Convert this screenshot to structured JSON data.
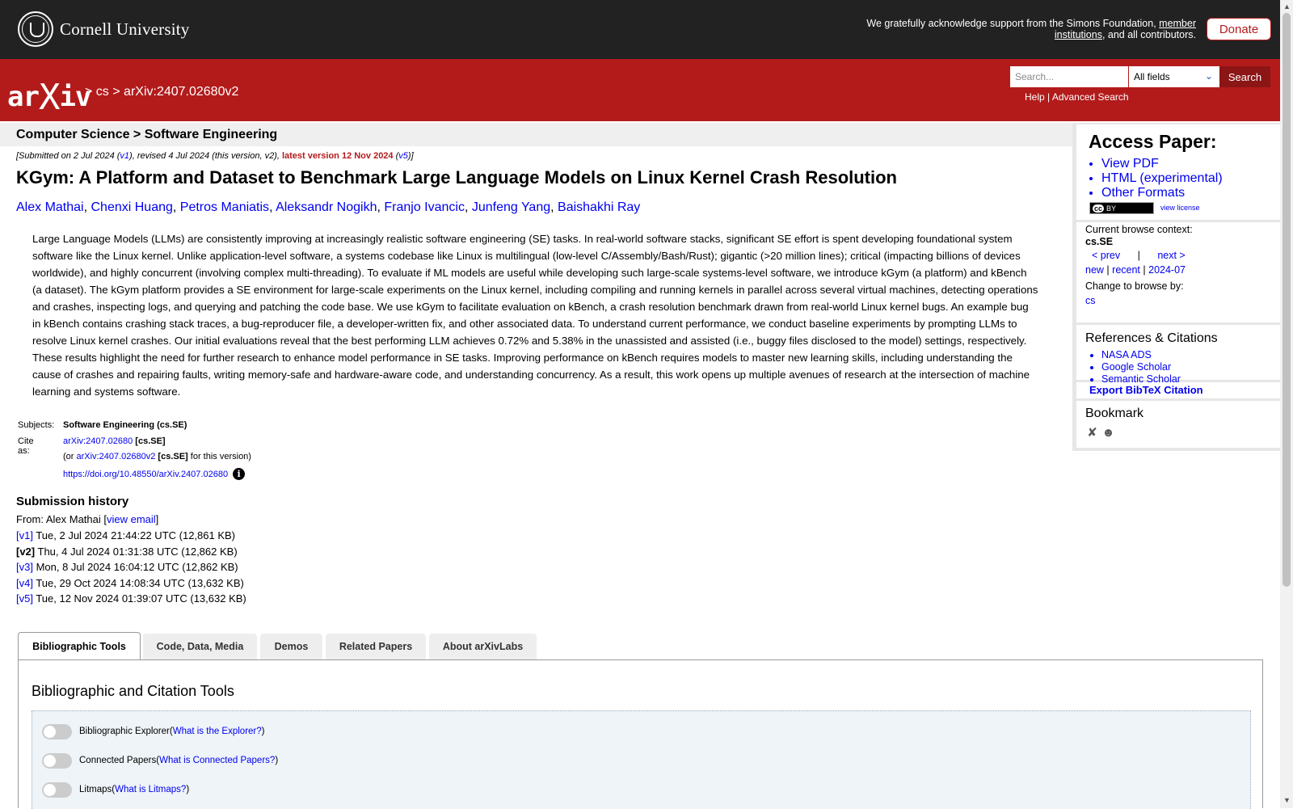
{
  "topbar": {
    "university": "Cornell University",
    "ack_prefix": "We gratefully acknowledge support from the Simons Foundation, ",
    "ack_link": "member institutions",
    "ack_suffix": ", and all contributors.",
    "donate": "Donate"
  },
  "header": {
    "logo_ar": "ar",
    "logo_x": "X",
    "logo_iv": "iv",
    "crumb_sep": ">",
    "crumb_cs": "cs",
    "crumb_id": "arXiv:2407.02680v2",
    "search_placeholder": "Search...",
    "field_select": "All fields",
    "search_button": "Search",
    "help": "Help",
    "help_sep": "|",
    "advanced": "Advanced Search"
  },
  "subject_bar": "Computer Science > Software Engineering",
  "submitted": {
    "p1": "[Submitted on 2 Jul 2024 (",
    "v1": "v1",
    "p2": "), revised 4 Jul 2024 (this version, v2), ",
    "latest": "latest version 12 Nov 2024",
    "p3": " (",
    "v5": "v5",
    "p4": ")]"
  },
  "title": "KGym: A Platform and Dataset to Benchmark Large Language Models on Linux Kernel Crash Resolution",
  "authors": [
    "Alex Mathai",
    "Chenxi Huang",
    "Petros Maniatis",
    "Aleksandr Nogikh",
    "Franjo Ivancic",
    "Junfeng Yang",
    "Baishakhi Ray"
  ],
  "abstract": "Large Language Models (LLMs) are consistently improving at increasingly realistic software engineering (SE) tasks. In real-world software stacks, significant SE effort is spent developing foundational system software like the Linux kernel. Unlike application-level software, a systems codebase like Linux is multilingual (low-level C/Assembly/Bash/Rust); gigantic (>20 million lines); critical (impacting billions of devices worldwide), and highly concurrent (involving complex multi-threading). To evaluate if ML models are useful while developing such large-scale systems-level software, we introduce kGym (a platform) and kBench (a dataset). The kGym platform provides a SE environment for large-scale experiments on the Linux kernel, including compiling and running kernels in parallel across several virtual machines, detecting operations and crashes, inspecting logs, and querying and patching the code base. We use kGym to facilitate evaluation on kBench, a crash resolution benchmark drawn from real-world Linux kernel bugs. An example bug in kBench contains crashing stack traces, a bug-reproducer file, a developer-written fix, and other associated data. To understand current performance, we conduct baseline experiments by prompting LLMs to resolve Linux kernel crashes. Our initial evaluations reveal that the best performing LLM achieves 0.72% and 5.38% in the unassisted and assisted (i.e., buggy files disclosed to the model) settings, respectively. These results highlight the need for further research to enhance model performance in SE tasks. Improving performance on kBench requires models to master new learning skills, including understanding the cause of crashes and repairing faults, writing memory-safe and hardware-aware code, and understanding concurrency. As a result, this work opens up multiple avenues of research at the intersection of machine learning and systems software.",
  "meta": {
    "subjects_label": "Subjects:",
    "subjects_value": "Software Engineering (cs.SE)",
    "cite_label": "Cite as:",
    "cite_id": "arXiv:2407.02680",
    "cite_cat": " [cs.SE]",
    "or_prefix": "(or ",
    "or_id": "arXiv:2407.02680v2",
    "or_cat": " [cs.SE]",
    "or_suffix": " for this version)",
    "doi": "https://doi.org/10.48550/arXiv.2407.02680",
    "info_glyph": "i"
  },
  "history": {
    "title": "Submission history",
    "from_prefix": "From: Alex Mathai [",
    "from_link": "view email",
    "from_suffix": "]",
    "versions": [
      {
        "tag": "[v1]",
        "text": " Tue, 2 Jul 2024 21:44:22 UTC (12,861 KB)",
        "link": true
      },
      {
        "tag": "[v2]",
        "text": " Thu, 4 Jul 2024 01:31:38 UTC (12,862 KB)",
        "link": false
      },
      {
        "tag": "[v3]",
        "text": " Mon, 8 Jul 2024 16:04:12 UTC (12,862 KB)",
        "link": true
      },
      {
        "tag": "[v4]",
        "text": " Tue, 29 Oct 2024 14:08:34 UTC (13,632 KB)",
        "link": true
      },
      {
        "tag": "[v5]",
        "text": " Tue, 12 Nov 2024 01:39:07 UTC (13,632 KB)",
        "link": true
      }
    ]
  },
  "tabs": [
    "Bibliographic Tools",
    "Code, Data, Media",
    "Demos",
    "Related Papers",
    "About arXivLabs"
  ],
  "panel": {
    "title": "Bibliographic and Citation Tools",
    "tools": [
      {
        "label": "Bibliographic Explorer",
        "open": " (",
        "link": "What is the Explorer?",
        "close": ")"
      },
      {
        "label": "Connected Papers",
        "open": " (",
        "link": "What is Connected Papers?",
        "close": ")"
      },
      {
        "label": "Litmaps",
        "open": " (",
        "link": "What is Litmaps?",
        "close": ")"
      }
    ]
  },
  "sidebar": {
    "access_title": "Access Paper:",
    "access_links": [
      "View PDF",
      "HTML (experimental)",
      "Other Formats"
    ],
    "cc_label": "cc",
    "cc_by": "BY",
    "view_license": "view license",
    "context_label": "Current browse context:",
    "context_value": "cs.SE",
    "prev": "< prev",
    "sep": "|",
    "next": "next >",
    "new": "new",
    "recent": "recent",
    "month": "2024-07",
    "change_label": "Change to browse by:",
    "change_value": "cs",
    "refs_title": "References & Citations",
    "refs": [
      "NASA ADS",
      "Google Scholar",
      "Semantic Scholar"
    ],
    "bibtex": "Export BibTeX Citation",
    "bookmark_title": "Bookmark"
  },
  "icons": {
    "dropdown": "chevron-down-icon",
    "info": "info-icon",
    "bookmark": [
      "bibsonomy-icon",
      "reddit-icon"
    ]
  },
  "colors": {
    "arxiv_red": "#b31b1b",
    "top_bar": "#222222",
    "link": "#0000ee"
  }
}
